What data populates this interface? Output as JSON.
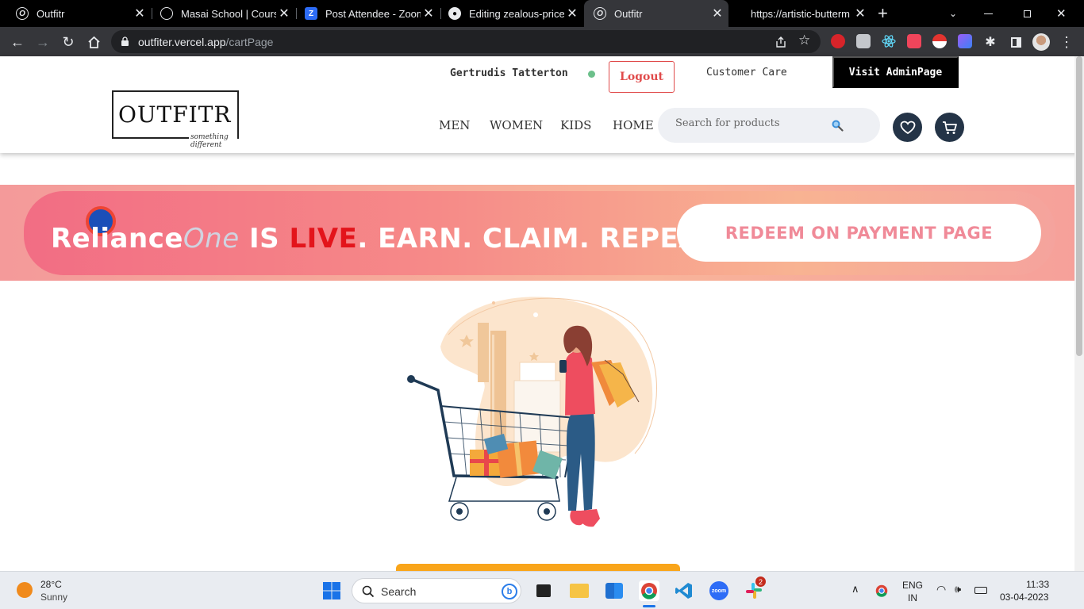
{
  "browser": {
    "tabs": [
      {
        "title": "Outfitr",
        "active": false
      },
      {
        "title": "Masai School | Course",
        "active": false
      },
      {
        "title": "Post Attendee - Zoom",
        "active": false
      },
      {
        "title": "Editing zealous-price-",
        "active": false
      },
      {
        "title": "Outfitr",
        "active": true
      },
      {
        "title": "https://artistic-butterm",
        "active": false
      }
    ],
    "new_tab_label": "+",
    "url": {
      "host": "outfiter.vercel.app",
      "path": "/cartPage"
    }
  },
  "header": {
    "logo_text": "OUTFITR",
    "logo_tagline": "something different",
    "user_name": "Gertrudis Tatterton",
    "logout_label": "Logout",
    "customer_care_label": "Customer Care",
    "admin_label": "Visit AdminPage",
    "nav": [
      "MEN",
      "WOMEN",
      "KIDS",
      "HOME"
    ],
    "search_placeholder": "Search for products"
  },
  "banner": {
    "brand": "Reliance",
    "brand_suffix": "One",
    "text_is": " IS ",
    "text_live": "LIVE",
    "text_rest": ". EARN. CLAIM. REPEAT.",
    "cta": "REDEEM ON PAYMENT PAGE"
  },
  "taskbar": {
    "temperature": "28°C",
    "weather": "Sunny",
    "search_label": "Search",
    "language": "ENG",
    "region": "IN",
    "time": "11:33",
    "date": "03-04-2023",
    "badge_count": "2"
  }
}
